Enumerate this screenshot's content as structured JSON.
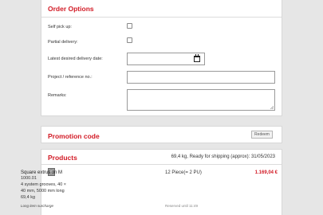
{
  "order_options": {
    "title": "Order Options",
    "self_pickup_label": "Self pick up:",
    "partial_delivery_label": "Partial delivery:",
    "delivery_date_label": "Latest desired delivery date:",
    "project_ref_label": "Project / reference no.:",
    "remarks_label": "Remarks:",
    "self_pickup_checked": false,
    "partial_delivery_checked": false,
    "delivery_date_value": "",
    "project_ref_value": "",
    "remarks_value": ""
  },
  "promotion": {
    "title": "Promotion code",
    "redeem_label": "Redeem"
  },
  "products": {
    "title": "Products",
    "shipping_info": "69,4 kg, Ready for shipping (approx): 31/05/2023",
    "items": [
      {
        "name": "Square extrusion M",
        "code": "1000.01",
        "spec_line1": "4 system grooves, 40 ×",
        "spec_line2": "40 mm, 5000 mm long",
        "weight": "69,4 kg",
        "surcharge": "Long item surcharge",
        "quantity": "12 Piece(= 2 PU)",
        "reserved": "Reserved until 11:49",
        "price": "1.169,04 €"
      }
    ]
  },
  "colors": {
    "accent": "#d21a25",
    "background": "#e6e6e6",
    "card": "#ffffff"
  }
}
